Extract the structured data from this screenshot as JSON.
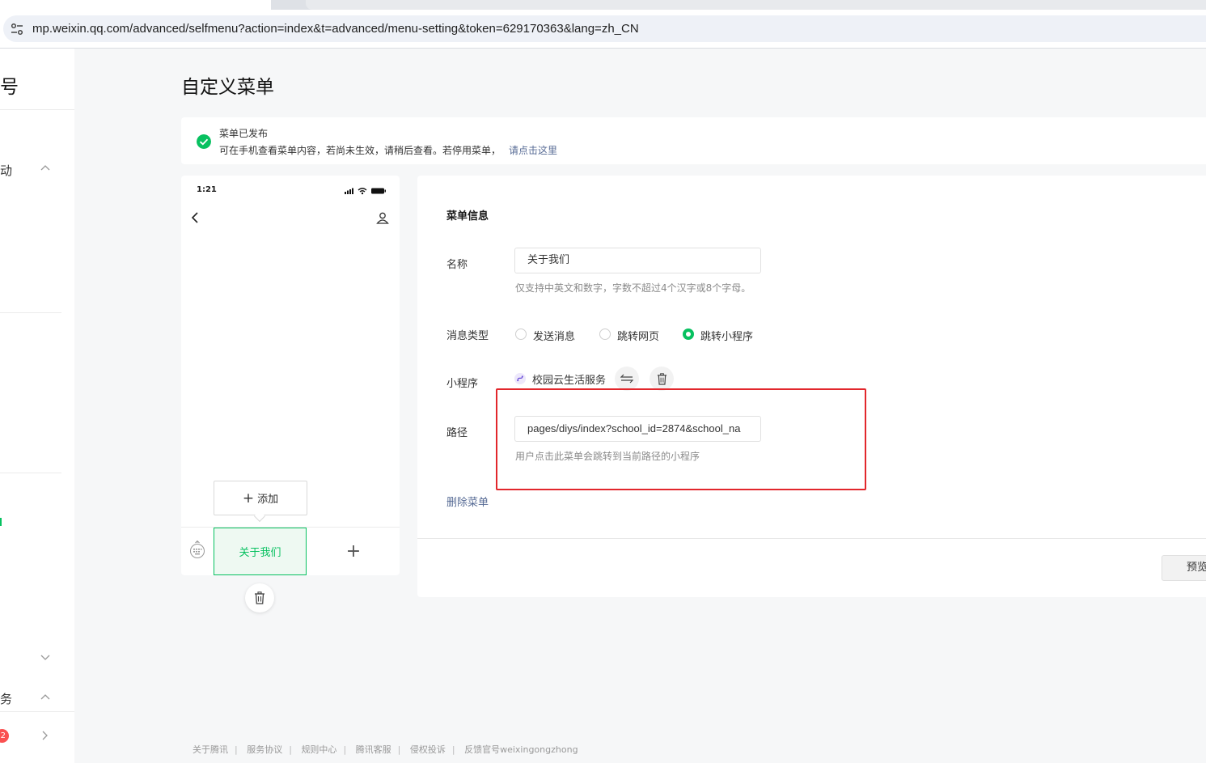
{
  "browser": {
    "url": "mp.weixin.qq.com/advanced/selfmenu?action=index&t=advanced/menu-setting&token=629170363&lang=zh_CN"
  },
  "sidebar": {
    "title_fragment": "号",
    "items": [
      {
        "label": "动",
        "chevron": "up"
      },
      {
        "label": "务",
        "chevron": "up"
      }
    ],
    "badge": "2"
  },
  "page": {
    "title": "自定义菜单"
  },
  "notice": {
    "title": "菜单已发布",
    "desc": "可在手机查看菜单内容，若尚未生效，请稍后查看。若停用菜单，",
    "link": "请点击这里"
  },
  "phone": {
    "time": "1:21",
    "add_label": "添加",
    "menu_item": "关于我们"
  },
  "form": {
    "section_title": "菜单信息",
    "name_label": "名称",
    "name_value": "关于我们",
    "name_hint": "仅支持中英文和数字，字数不超过4个汉字或8个字母。",
    "type_label": "消息类型",
    "type_options": [
      "发送消息",
      "跳转网页",
      "跳转小程序"
    ],
    "type_selected": "跳转小程序",
    "miniprogram_label": "小程序",
    "miniprogram_name": "校园云生活服务",
    "path_label": "路径",
    "path_value": "pages/diys/index?school_id=2874&school_na",
    "path_hint": "用户点击此菜单会跳转到当前路径的小程序",
    "delete_label": "删除菜单",
    "preview_label": "预览"
  },
  "footer": {
    "links": [
      "关于腾讯",
      "服务协议",
      "规则中心",
      "腾讯客服",
      "侵权投诉",
      "反馈官号weixingongzhong"
    ]
  },
  "colors": {
    "accent": "#07c160",
    "link": "#576b95",
    "highlight": "#e2272c"
  }
}
